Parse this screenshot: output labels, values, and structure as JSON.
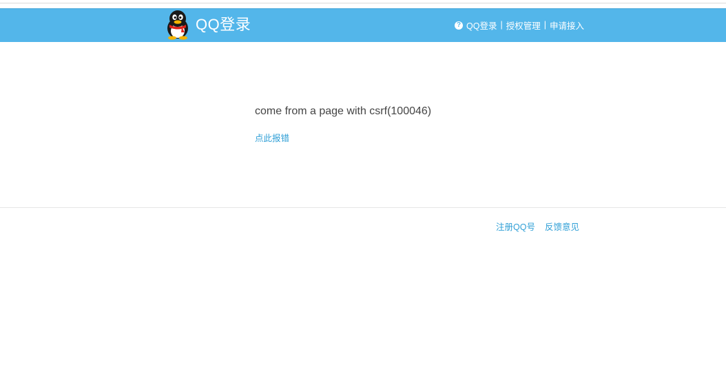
{
  "header": {
    "brand": "QQ登录",
    "logo_icon": "qq-penguin-icon",
    "background_color": "#53b6ea",
    "nav": {
      "help_icon": "question-circle-icon",
      "qq_login": "QQ登录",
      "separator": "|",
      "auth_manage": "授权管理",
      "apply_access": "申请接入"
    }
  },
  "main": {
    "error_message": "come from a page with csrf(100046)",
    "report_link": "点此报错"
  },
  "footer": {
    "register": "注册QQ号",
    "feedback": "反馈意见"
  }
}
